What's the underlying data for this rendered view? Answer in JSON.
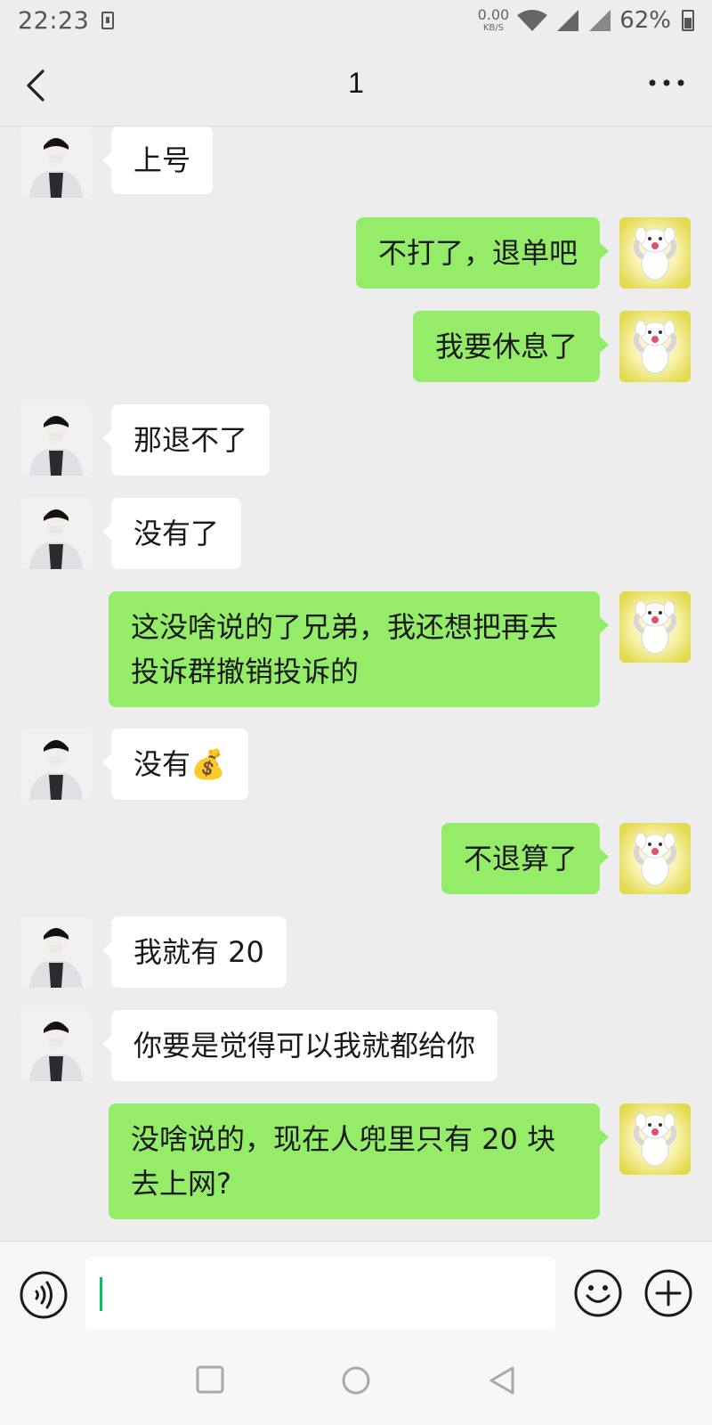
{
  "status_bar": {
    "time": "22:23",
    "net_speed_value": "0.00",
    "net_speed_unit": "KB/S",
    "battery": "62%",
    "battery_level": 0.62
  },
  "header": {
    "title": "1"
  },
  "messages": [
    {
      "side": "in",
      "text": "上号"
    },
    {
      "side": "out",
      "text": "不打了，退单吧"
    },
    {
      "side": "out",
      "text": "我要休息了"
    },
    {
      "side": "in",
      "text": "那退不了"
    },
    {
      "side": "in",
      "text": "没有了"
    },
    {
      "side": "out",
      "text": "这没啥说的了兄弟，我还想把再去投诉群撤销投诉的"
    },
    {
      "side": "in",
      "text": "没有💰"
    },
    {
      "side": "out",
      "text": "不退算了"
    },
    {
      "side": "in",
      "text": "我就有 20"
    },
    {
      "side": "in",
      "text": "你要是觉得可以我就都给你"
    },
    {
      "side": "out",
      "text": "没啥说的，现在人兜里只有 20 块去上网?"
    }
  ],
  "input": {
    "value": ""
  },
  "colors": {
    "background": "#ededed",
    "bubble_out": "#95ec69",
    "bubble_in": "#ffffff",
    "caret": "#07c160"
  }
}
